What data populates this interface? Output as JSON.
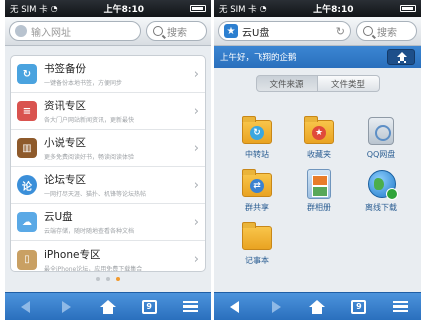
{
  "status_bar": {
    "carrier": "无 SIM 卡",
    "time": "上午8:10"
  },
  "left": {
    "search": {
      "url_placeholder": "输入网址",
      "search_label": "搜索"
    },
    "items": [
      {
        "title": "书签备份",
        "sub": "一键备份本地书签，方便同步",
        "icon": "bookmark-icon",
        "color": "#4aa3df"
      },
      {
        "title": "资讯专区",
        "sub": "各大门户网站新闻资讯，更新最快",
        "icon": "news-icon",
        "color": "#d9534f"
      },
      {
        "title": "小说专区",
        "sub": "更多免费阅读好书，畅读阅读体验",
        "icon": "books-icon",
        "color": "#8e5a2b"
      },
      {
        "title": "论坛专区",
        "sub": "一网打尽天涯、猫扑、机锋等论坛热帖",
        "icon": "forum-icon",
        "color": "#3b8fd9"
      },
      {
        "title": "云U盘",
        "sub": "云端存储，随时随地查看各种文档",
        "icon": "cloud-drive-icon",
        "color": "#5aa9e6"
      },
      {
        "title": "iPhone专区",
        "sub": "最全iPhone论坛，应用免费下载集合",
        "icon": "iphone-icon",
        "color": "#c9a063"
      }
    ],
    "toolbar": {
      "tabs_count": "9"
    }
  },
  "right": {
    "search": {
      "url_value": "云U盘",
      "search_label": "搜索"
    },
    "greeting": "上午好，飞翔的企鹅",
    "segments": [
      "文件来源",
      "文件类型"
    ],
    "folders": [
      {
        "label": "中转站",
        "icon": "transfer-folder-icon"
      },
      {
        "label": "收藏夹",
        "icon": "favorites-folder-icon"
      },
      {
        "label": "QQ网盘",
        "icon": "qq-disk-icon"
      },
      {
        "label": "群共享",
        "icon": "group-share-folder-icon"
      },
      {
        "label": "群相册",
        "icon": "group-album-icon"
      },
      {
        "label": "离线下载",
        "icon": "offline-download-icon"
      },
      {
        "label": "记事本",
        "icon": "notepad-folder-icon"
      }
    ],
    "toolbar": {
      "tabs_count": "9"
    }
  },
  "colors": {
    "accent": "#2a6fbd",
    "page_dot_active": "#f29a2e"
  }
}
